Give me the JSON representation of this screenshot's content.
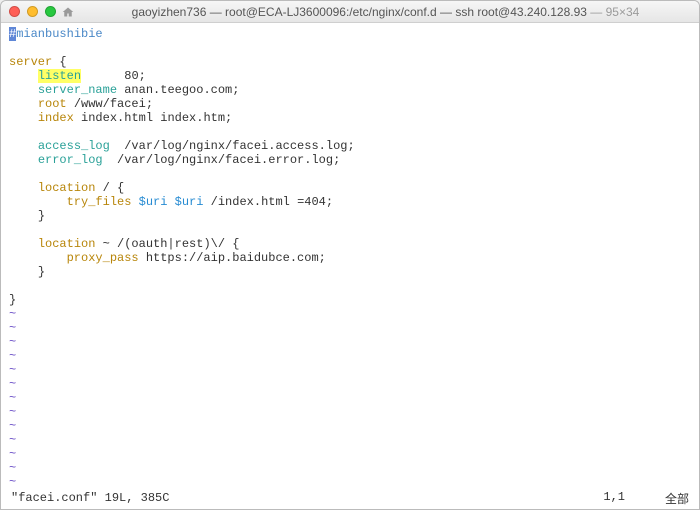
{
  "titlebar": {
    "user": "gaoyizhen736",
    "path": "root@ECA-LJ3600096:/etc/nginx/conf.d",
    "ssh": "ssh root@43.240.128.93",
    "dims": "95×34",
    "full_left": "gaoyizhen736 — root@ECA-LJ3600096:/etc/nginx/conf.d — ssh root@43.240.128.93",
    "full_right": " — 95×34"
  },
  "code": {
    "comment_hash": "#",
    "comment_text": "mianbushibie",
    "server_kw": "server",
    "lbrace": " {",
    "listen_kw": "listen",
    "listen_val": "      80;",
    "server_name_kw": "server_name",
    "server_name_val": " anan.teegoo.com;",
    "root_kw": "root",
    "root_val": " /www/facei;",
    "index_kw": "index",
    "index_val": " index.html index.htm;",
    "access_log_kw": "access_log",
    "access_log_val": "  /var/log/nginx/facei.access.log;",
    "error_log_kw": "error_log",
    "error_log_val": "  /var/log/nginx/facei.error.log;",
    "location1_kw": "location",
    "location1_arg": " / {",
    "try_files_kw": "try_files",
    "uri_var": "$uri",
    "try_files_tail": " /index.html =404;",
    "rbrace": "}",
    "location2_kw": "location",
    "location2_arg": " ~ /(oauth|rest)\\/ {",
    "proxy_pass_kw": "proxy_pass",
    "proxy_pass_val": " https://aip.baidubce.com;",
    "tilde": "~",
    "indent1": "    ",
    "indent2": "        "
  },
  "status": {
    "left": "\"facei.conf\" 19L, 385C",
    "pos": "1,1",
    "mode": "全部"
  }
}
